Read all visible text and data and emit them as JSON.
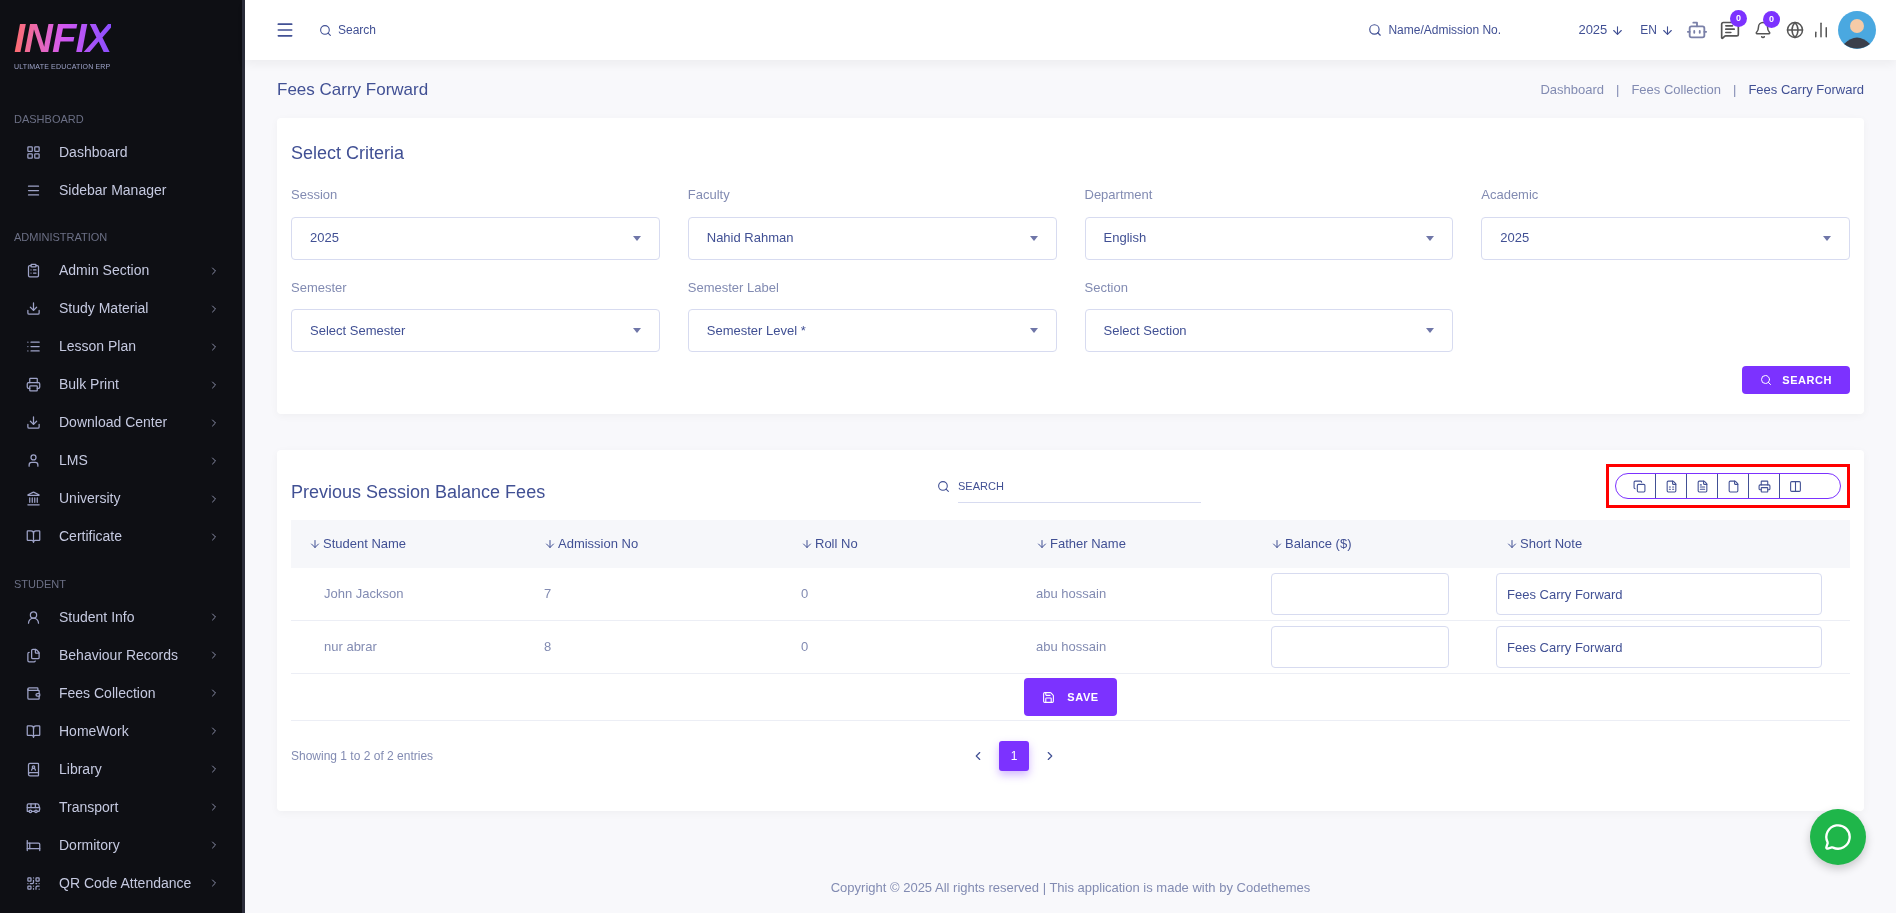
{
  "logo": {
    "name": "INFIX",
    "tagline": "ULTIMATE EDUCATION ERP"
  },
  "sidebar": {
    "sections": [
      {
        "title": "DASHBOARD",
        "items": [
          {
            "label": "Dashboard",
            "expandable": false
          },
          {
            "label": "Sidebar Manager",
            "expandable": false
          }
        ]
      },
      {
        "title": "ADMINISTRATION",
        "items": [
          {
            "label": "Admin Section",
            "expandable": true
          },
          {
            "label": "Study Material",
            "expandable": true
          },
          {
            "label": "Lesson Plan",
            "expandable": true
          },
          {
            "label": "Bulk Print",
            "expandable": true
          },
          {
            "label": "Download Center",
            "expandable": true
          },
          {
            "label": "LMS",
            "expandable": true
          },
          {
            "label": "University",
            "expandable": true
          },
          {
            "label": "Certificate",
            "expandable": true
          }
        ]
      },
      {
        "title": "STUDENT",
        "items": [
          {
            "label": "Student Info",
            "expandable": true
          },
          {
            "label": "Behaviour Records",
            "expandable": true
          },
          {
            "label": "Fees Collection",
            "expandable": true
          },
          {
            "label": "HomeWork",
            "expandable": true
          },
          {
            "label": "Library",
            "expandable": true
          },
          {
            "label": "Transport",
            "expandable": true
          },
          {
            "label": "Dormitory",
            "expandable": true
          },
          {
            "label": "QR Code Attendance",
            "expandable": true
          }
        ]
      }
    ]
  },
  "topbar": {
    "search": {
      "placeholder": "Search"
    },
    "student_search": {
      "placeholder": "Name/Admission No."
    },
    "year": "2025",
    "language": "EN",
    "messages_badge": "0",
    "notifications_badge": "0"
  },
  "page": {
    "title": "Fees Carry Forward",
    "breadcrumbs": [
      "Dashboard",
      "Fees Collection",
      "Fees Carry Forward"
    ],
    "breadcrumb_separator": "|"
  },
  "criteria": {
    "title": "Select Criteria",
    "fields": [
      {
        "label": "Session",
        "value": "2025"
      },
      {
        "label": "Faculty",
        "value": "Nahid Rahman"
      },
      {
        "label": "Department",
        "value": "English"
      },
      {
        "label": "Academic",
        "value": "2025"
      },
      {
        "label": "Semester",
        "value": "Select Semester"
      },
      {
        "label": "Semester Label",
        "value": "Semester Level *"
      },
      {
        "label": "Section",
        "value": "Select Section"
      }
    ],
    "search_button": "SEARCH"
  },
  "balance_table": {
    "title": "Previous Session Balance Fees",
    "search": {
      "placeholder": "SEARCH"
    },
    "export_highlighted": true,
    "columns": [
      "Student Name",
      "Admission No",
      "Roll No",
      "Father Name",
      "Balance ($)",
      "Short Note"
    ],
    "rows": [
      {
        "student_name": "John Jackson",
        "admission_no": "7",
        "roll_no": "0",
        "father_name": "abu hossain",
        "short_note": "Fees Carry Forward"
      },
      {
        "student_name": "nur abrar",
        "admission_no": "8",
        "roll_no": "0",
        "father_name": "abu hossain",
        "short_note": "Fees Carry Forward"
      }
    ],
    "save_button": "SAVE",
    "info": "Showing 1 to 2 of 2 entries",
    "pages": [
      {
        "label": "1",
        "selected": true
      }
    ]
  },
  "footer": "Copyright © 2025 All rights reserved | This application is made with by Codethemes"
}
